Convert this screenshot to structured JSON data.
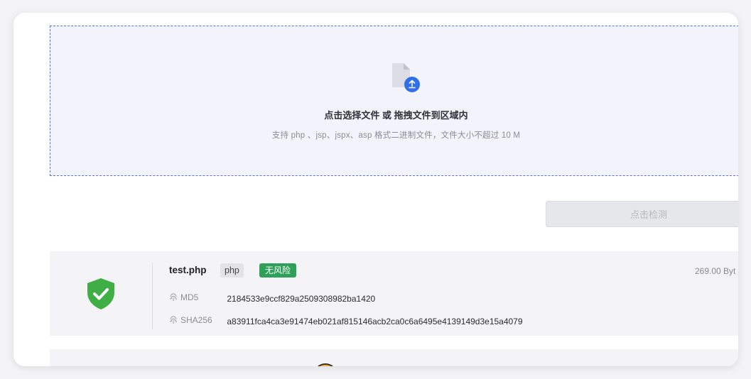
{
  "upload": {
    "title": "点击选择文件 或 拖拽文件到区域内",
    "hint": "支持 php 、jsp、jspx、asp 格式二进制文件，文件大小不超过 10 M",
    "icon": "file-upload-icon"
  },
  "actions": {
    "detect_label": "点击检测"
  },
  "result": {
    "status_icon": "shield-check-icon",
    "file_name": "test.php",
    "extension": "php",
    "risk_badge": "无风险",
    "file_size": "269.00 Byt",
    "md5_label": "MD5",
    "md5_value": "2184533e9ccf829a2509308982ba1420",
    "sha256_label": "SHA256",
    "sha256_value": "a83911fca4ca3e91474eb021af815146acb2ca0c6a6495e4139149d3e15a4079"
  },
  "colors": {
    "accent": "#3b6ee5",
    "safe": "#2ea05a",
    "shield": "#3fae45"
  }
}
